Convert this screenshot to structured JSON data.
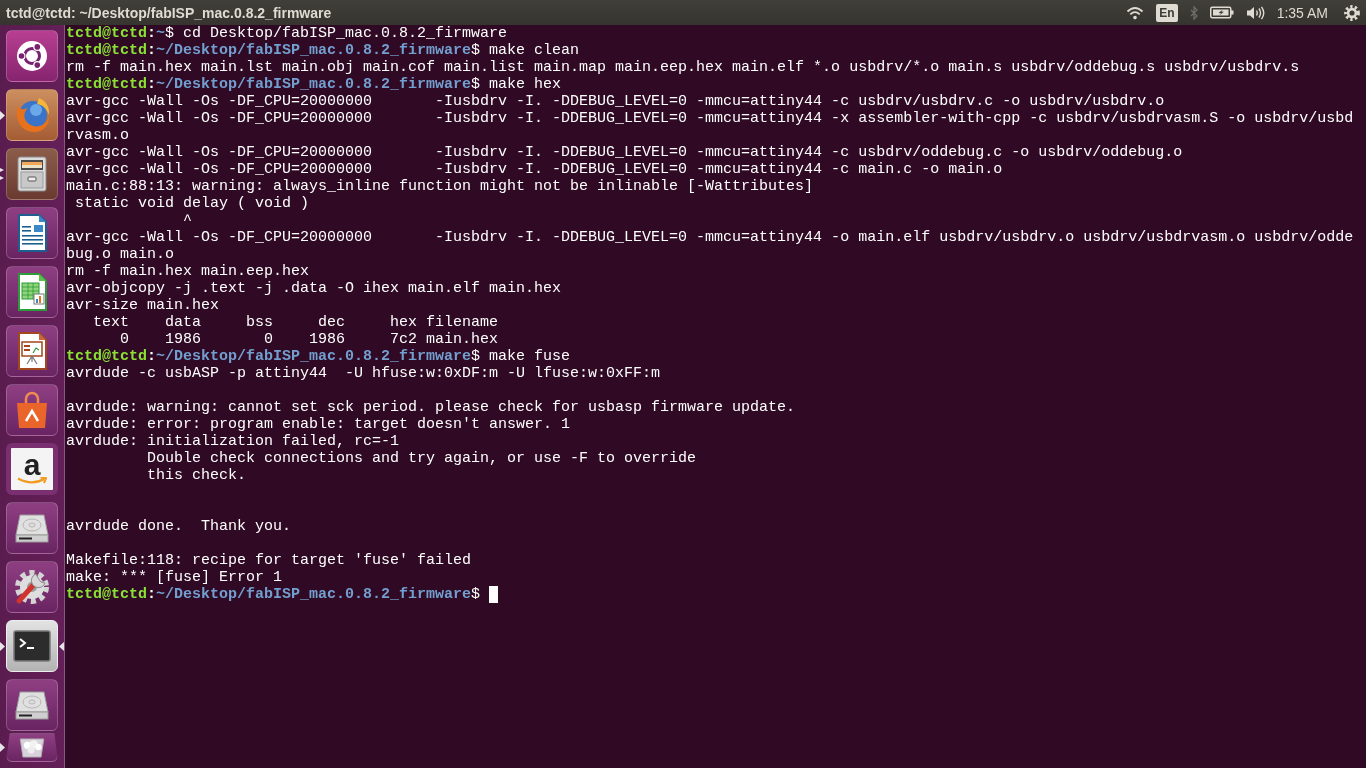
{
  "top_bar": {
    "title": "tctd@tctd: ~/Desktop/fabISP_mac.0.8.2_firmware",
    "indicators": [
      {
        "kind": "wifi",
        "dimmed": false
      },
      {
        "kind": "keyboard",
        "label": "En",
        "dimmed": false
      },
      {
        "kind": "bluetooth",
        "dimmed": true
      },
      {
        "kind": "battery",
        "dimmed": false
      },
      {
        "kind": "volume",
        "dimmed": false
      },
      {
        "kind": "clock",
        "label": "1:35 AM",
        "dimmed": false
      },
      {
        "kind": "session",
        "dimmed": false
      }
    ]
  },
  "launcher": {
    "items": [
      {
        "kind": "dash",
        "running": false,
        "multi_window": false,
        "focused": false
      },
      {
        "kind": "browser",
        "running": true,
        "multi_window": false,
        "focused": false
      },
      {
        "kind": "files",
        "running": true,
        "multi_window": true,
        "focused": false
      },
      {
        "kind": "writer",
        "running": false,
        "multi_window": false,
        "focused": false
      },
      {
        "kind": "spreadsheet",
        "running": false,
        "multi_window": false,
        "focused": false
      },
      {
        "kind": "slides",
        "running": false,
        "multi_window": false,
        "focused": false
      },
      {
        "kind": "software",
        "running": false,
        "multi_window": false,
        "focused": false
      },
      {
        "kind": "shop",
        "glyph": "a",
        "running": false,
        "multi_window": false,
        "focused": false
      },
      {
        "kind": "drive",
        "running": false,
        "multi_window": false,
        "focused": false
      },
      {
        "kind": "settings",
        "running": false,
        "multi_window": false,
        "focused": false
      },
      {
        "kind": "terminal",
        "running": true,
        "multi_window": false,
        "focused": true
      },
      {
        "kind": "drive",
        "running": false,
        "multi_window": false,
        "focused": false
      },
      {
        "kind": "trash",
        "running": true,
        "multi_window": false,
        "focused": false
      }
    ]
  },
  "terminal": {
    "cursor": true,
    "lines": [
      {
        "kind": "prompt",
        "user_host": "tctd@tctd",
        "separator": ":",
        "path": "~",
        "symbol": "$",
        "command": "cd Desktop/fabISP_mac.0.8.2_firmware"
      },
      {
        "kind": "prompt",
        "user_host": "tctd@tctd",
        "separator": ":",
        "path": "~/Desktop/fabISP_mac.0.8.2_firmware",
        "symbol": "$",
        "command": "make clean"
      },
      {
        "kind": "output",
        "text": "rm -f main.hex main.lst main.obj main.cof main.list main.map main.eep.hex main.elf *.o usbdrv/*.o main.s usbdrv/oddebug.s usbdrv/usbdrv.s"
      },
      {
        "kind": "prompt",
        "user_host": "tctd@tctd",
        "separator": ":",
        "path": "~/Desktop/fabISP_mac.0.8.2_firmware",
        "symbol": "$",
        "command": "make hex"
      },
      {
        "kind": "output",
        "text": "avr-gcc -Wall -Os -DF_CPU=20000000       -Iusbdrv -I. -DDEBUG_LEVEL=0 -mmcu=attiny44 -c usbdrv/usbdrv.c -o usbdrv/usbdrv.o"
      },
      {
        "kind": "output",
        "text": "avr-gcc -Wall -Os -DF_CPU=20000000       -Iusbdrv -I. -DDEBUG_LEVEL=0 -mmcu=attiny44 -x assembler-with-cpp -c usbdrv/usbdrvasm.S -o usbdrv/usbd"
      },
      {
        "kind": "output",
        "text": "rvasm.o"
      },
      {
        "kind": "output",
        "text": "avr-gcc -Wall -Os -DF_CPU=20000000       -Iusbdrv -I. -DDEBUG_LEVEL=0 -mmcu=attiny44 -c usbdrv/oddebug.c -o usbdrv/oddebug.o"
      },
      {
        "kind": "output",
        "text": "avr-gcc -Wall -Os -DF_CPU=20000000       -Iusbdrv -I. -DDEBUG_LEVEL=0 -mmcu=attiny44 -c main.c -o main.o"
      },
      {
        "kind": "output",
        "text": "main.c:88:13: warning: always_inline function might not be inlinable [-Wattributes]"
      },
      {
        "kind": "output",
        "text": " static void delay ( void )"
      },
      {
        "kind": "output",
        "text": "             ^"
      },
      {
        "kind": "output",
        "text": "avr-gcc -Wall -Os -DF_CPU=20000000       -Iusbdrv -I. -DDEBUG_LEVEL=0 -mmcu=attiny44 -o main.elf usbdrv/usbdrv.o usbdrv/usbdrvasm.o usbdrv/odde"
      },
      {
        "kind": "output",
        "text": "bug.o main.o"
      },
      {
        "kind": "output",
        "text": "rm -f main.hex main.eep.hex"
      },
      {
        "kind": "output",
        "text": "avr-objcopy -j .text -j .data -O ihex main.elf main.hex"
      },
      {
        "kind": "output",
        "text": "avr-size main.hex"
      },
      {
        "kind": "output",
        "text": "   text    data     bss     dec     hex filename"
      },
      {
        "kind": "output",
        "text": "      0    1986       0    1986     7c2 main.hex"
      },
      {
        "kind": "prompt",
        "user_host": "tctd@tctd",
        "separator": ":",
        "path": "~/Desktop/fabISP_mac.0.8.2_firmware",
        "symbol": "$",
        "command": "make fuse"
      },
      {
        "kind": "output",
        "text": "avrdude -c usbASP -p attiny44  -U hfuse:w:0xDF:m -U lfuse:w:0xFF:m"
      },
      {
        "kind": "blank"
      },
      {
        "kind": "output",
        "text": "avrdude: warning: cannot set sck period. please check for usbasp firmware update."
      },
      {
        "kind": "output",
        "text": "avrdude: error: program enable: target doesn't answer. 1"
      },
      {
        "kind": "output",
        "text": "avrdude: initialization failed, rc=-1"
      },
      {
        "kind": "output",
        "text": "         Double check connections and try again, or use -F to override"
      },
      {
        "kind": "output",
        "text": "         this check."
      },
      {
        "kind": "blank"
      },
      {
        "kind": "blank"
      },
      {
        "kind": "output",
        "text": "avrdude done.  Thank you."
      },
      {
        "kind": "blank"
      },
      {
        "kind": "output",
        "text": "Makefile:118: recipe for target 'fuse' failed"
      },
      {
        "kind": "output",
        "text": "make: *** [fuse] Error 1"
      },
      {
        "kind": "prompt",
        "user_host": "tctd@tctd",
        "separator": ":",
        "path": "~/Desktop/fabISP_mac.0.8.2_firmware",
        "symbol": "$"
      }
    ]
  }
}
